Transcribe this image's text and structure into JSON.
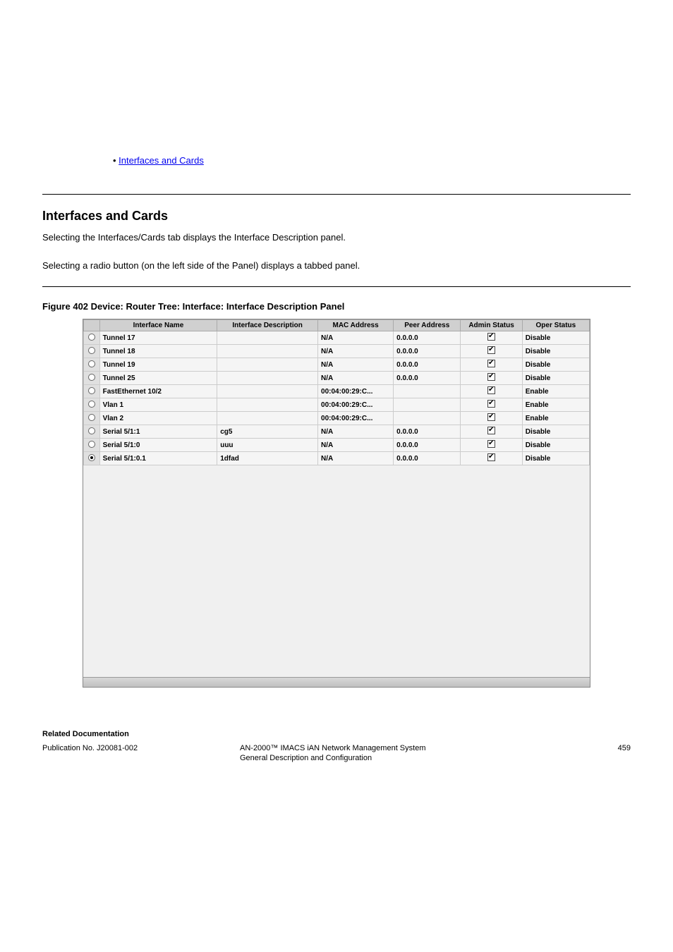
{
  "bullet_link": "Interfaces and Cards",
  "section_title": "Interfaces and Cards",
  "section_text_1": "Selecting the Interfaces/Cards tab displays the Interface Description panel.",
  "section_text_2": "Selecting a radio button (on the left side of the Panel) displays a tabbed panel.",
  "figure_caption": "Figure 402  Device: Router Tree: Interface: Interface Description Panel",
  "table": {
    "headers": [
      "",
      "Interface Name",
      "Interface Description",
      "MAC Address",
      "Peer Address",
      "Admin Status",
      "Oper Status"
    ],
    "rows": [
      {
        "selected": false,
        "iface": "Tunnel 17",
        "desc": "",
        "mac": "N/A",
        "peer": "0.0.0.0",
        "admin": true,
        "oper": "Disable"
      },
      {
        "selected": false,
        "iface": "Tunnel 18",
        "desc": "",
        "mac": "N/A",
        "peer": "0.0.0.0",
        "admin": true,
        "oper": "Disable"
      },
      {
        "selected": false,
        "iface": "Tunnel 19",
        "desc": "",
        "mac": "N/A",
        "peer": "0.0.0.0",
        "admin": true,
        "oper": "Disable"
      },
      {
        "selected": false,
        "iface": "Tunnel 25",
        "desc": "",
        "mac": "N/A",
        "peer": "0.0.0.0",
        "admin": true,
        "oper": "Disable"
      },
      {
        "selected": false,
        "iface": "FastEthernet 10/2",
        "desc": "",
        "mac": "00:04:00:29:C...",
        "peer": "",
        "admin": true,
        "oper": "Enable"
      },
      {
        "selected": false,
        "iface": "Vlan 1",
        "desc": "",
        "mac": "00:04:00:29:C...",
        "peer": "",
        "admin": true,
        "oper": "Enable"
      },
      {
        "selected": false,
        "iface": "Vlan 2",
        "desc": "",
        "mac": "00:04:00:29:C...",
        "peer": "",
        "admin": true,
        "oper": "Enable"
      },
      {
        "selected": false,
        "iface": "Serial 5/1:1",
        "desc": "cg5",
        "mac": "N/A",
        "peer": "0.0.0.0",
        "admin": true,
        "oper": "Disable"
      },
      {
        "selected": false,
        "iface": "Serial 5/1:0",
        "desc": "uuu",
        "mac": "N/A",
        "peer": "0.0.0.0",
        "admin": true,
        "oper": "Disable"
      },
      {
        "selected": true,
        "iface": "Serial 5/1:0.1",
        "desc": "1dfad",
        "mac": "N/A",
        "peer": "0.0.0.0",
        "admin": true,
        "oper": "Disable"
      }
    ]
  },
  "related_docs_heading": "Related Documentation",
  "pub_number": "Publication No. J20081-002",
  "pub_title": "AN-2000™ IMACS iAN Network Management System",
  "pub_page": "459",
  "pub_subtitle": "General Description and Configuration"
}
